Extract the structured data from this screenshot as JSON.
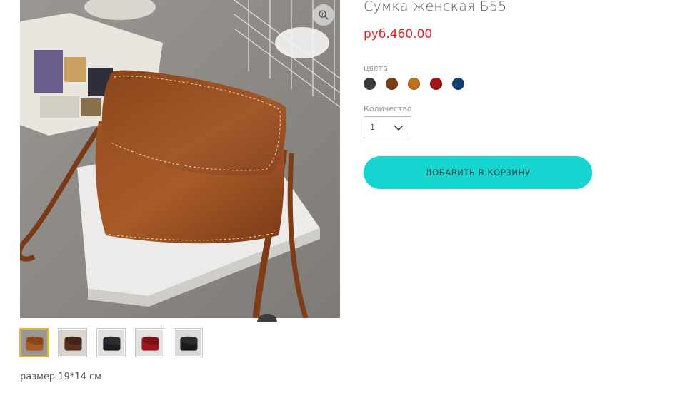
{
  "product": {
    "title": "Сумка женская Б55",
    "price": "руб.460.00",
    "description": "размер 19*14 см"
  },
  "options": {
    "colors_label": "цвета",
    "colors": [
      {
        "name": "black",
        "hex": "#3b3b3b"
      },
      {
        "name": "brown",
        "hex": "#7a3f12"
      },
      {
        "name": "tan",
        "hex": "#c0711c"
      },
      {
        "name": "red",
        "hex": "#a11616"
      },
      {
        "name": "navy",
        "hex": "#123f73"
      }
    ],
    "quantity_label": "Количество",
    "quantity_value": "1"
  },
  "actions": {
    "add_to_cart": "ДОБАВИТЬ В КОРЗИНУ"
  },
  "gallery": {
    "thumbnails": [
      {
        "color": "tan",
        "hex": "#a85a26",
        "selected": true
      },
      {
        "color": "brown",
        "hex": "#5a3020",
        "selected": false
      },
      {
        "color": "black",
        "hex": "#1e1e22",
        "selected": false
      },
      {
        "color": "red",
        "hex": "#9a1820",
        "selected": false
      },
      {
        "color": "black-2",
        "hex": "#1a1a1a",
        "selected": false
      }
    ],
    "icons": {
      "zoom": "zoom-in-icon",
      "next": "chevron-right-icon"
    }
  },
  "colors": {
    "price": "#e3222a",
    "button": "#16d4cf",
    "thumbnail_active_border": "#e0b43a"
  }
}
